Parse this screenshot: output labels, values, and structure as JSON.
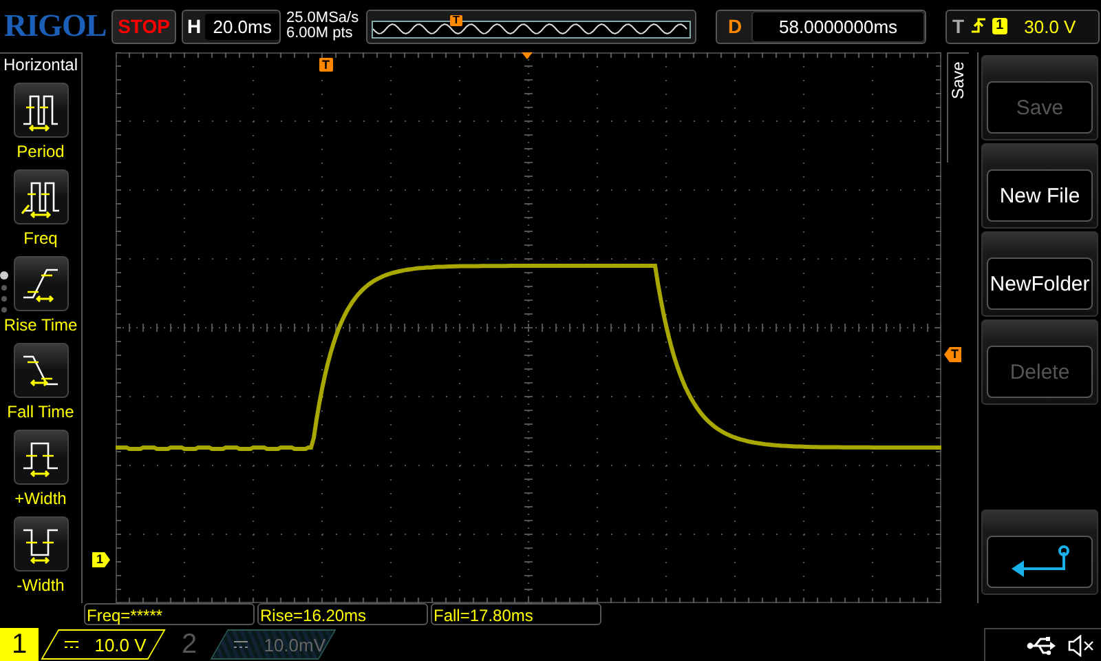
{
  "brand": "RIGOL",
  "run_state": {
    "label": "STOP"
  },
  "horizontal": {
    "label": "H",
    "timebase": "20.0ms"
  },
  "acquisition": {
    "sample_rate": "25.0MSa/s",
    "memory_depth": "6.00M pts"
  },
  "overview": {
    "marker": "T"
  },
  "delay": {
    "label": "D",
    "value": "58.0000000ms"
  },
  "trigger": {
    "label": "T",
    "channel": "1",
    "level": "30.0 V"
  },
  "measure_menu": {
    "title": "Horizontal",
    "items": [
      {
        "label": "Period",
        "kind": "period"
      },
      {
        "label": "Freq",
        "kind": "freq"
      },
      {
        "label": "Rise Time",
        "kind": "rise"
      },
      {
        "label": "Fall Time",
        "kind": "fall"
      },
      {
        "label": "+Width",
        "kind": "pwidth"
      },
      {
        "label": "-Width",
        "kind": "nwidth"
      }
    ]
  },
  "menu_pages": [
    {
      "selected": true
    },
    {
      "selected": false
    },
    {
      "selected": false
    },
    {
      "selected": false
    }
  ],
  "markers": {
    "trigger_position": "T",
    "trigger_level": "T",
    "channel": "1"
  },
  "measurements": [
    "Freq=*****",
    "Rise=16.20ms",
    "Fall=17.80ms"
  ],
  "save_menu": {
    "title": "Save",
    "buttons": [
      {
        "kind": "text",
        "label": "Save",
        "disabled": true
      },
      {
        "kind": "text",
        "label": "New File",
        "disabled": false
      },
      {
        "kind": "text",
        "label": "NewFolder",
        "disabled": false
      },
      {
        "kind": "text",
        "label": "Delete",
        "disabled": true
      },
      {
        "kind": "back"
      }
    ]
  },
  "channels": [
    {
      "number": "1",
      "scale": "10.0 V",
      "on": true
    },
    {
      "number": "2",
      "scale": "10.0mV",
      "on": false
    }
  ]
}
